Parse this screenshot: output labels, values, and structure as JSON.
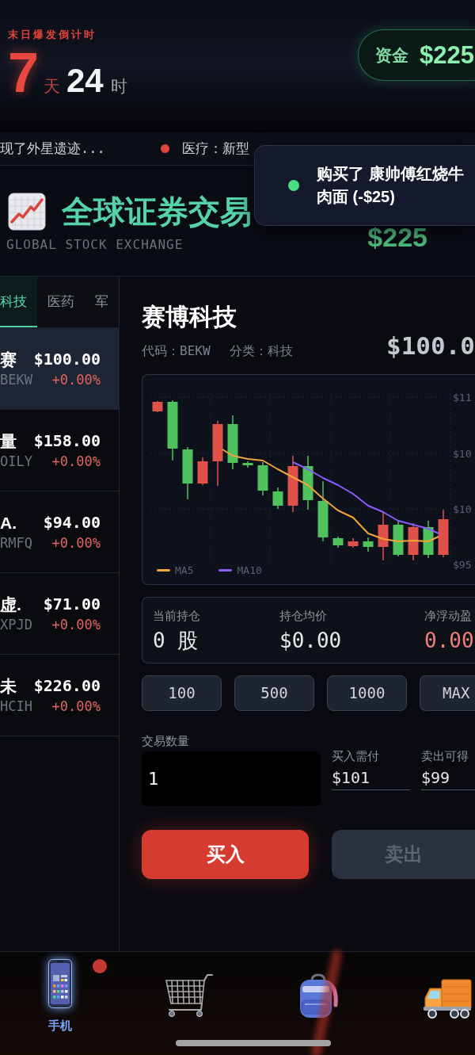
{
  "countdown": {
    "title": "末日爆发倒计时",
    "days": "7",
    "days_unit": "天",
    "hours": "24",
    "hours_unit": "时"
  },
  "funds": {
    "label": "资金",
    "amount": "$225"
  },
  "ticker": [
    {
      "text": "现了外星遗迹...",
      "bullet": false
    },
    {
      "text": "医疗：新型",
      "bullet": true
    }
  ],
  "toast": {
    "text": "购买了 康帅傅红烧牛肉面 (-$25)"
  },
  "exchange": {
    "title": "全球证券交易",
    "subtitle": "GLOBAL STOCK EXCHANGE",
    "balance": "$225"
  },
  "sectors": [
    {
      "label": "科技",
      "selected": true
    },
    {
      "label": "医药",
      "selected": false
    },
    {
      "label": "军",
      "selected": false
    }
  ],
  "stocks": [
    {
      "name": "赛",
      "code": "BEKW",
      "price": "$100.00",
      "change": "+0.00%",
      "selected": true
    },
    {
      "name": "量",
      "code": "OILY",
      "price": "$158.00",
      "change": "+0.00%",
      "selected": false
    },
    {
      "name": "A.",
      "code": "RMFQ",
      "price": "$94.00",
      "change": "+0.00%",
      "selected": false
    },
    {
      "name": "虚.",
      "code": "XPJD",
      "price": "$71.00",
      "change": "+0.00%",
      "selected": false
    },
    {
      "name": "未",
      "code": "HCIH",
      "price": "$226.00",
      "change": "+0.00%",
      "selected": false
    }
  ],
  "detail": {
    "name": "赛博科技",
    "code": "代码：BEKW",
    "sector": "分类：科技",
    "price": "$100.0"
  },
  "chart": {
    "y_labels": [
      "$11",
      "$10",
      "$10",
      "$95"
    ],
    "legend": [
      {
        "name": "MA5",
        "color": "#f0a43a"
      },
      {
        "name": "MA10",
        "color": "#8b5cf6"
      }
    ]
  },
  "position": [
    {
      "label": "当前持仓",
      "value": "0 股",
      "kind": "plain"
    },
    {
      "label": "持仓均价",
      "value": "$0.00",
      "kind": "plain"
    },
    {
      "label": "净浮动盈",
      "value": "0.00",
      "kind": "pnl"
    }
  ],
  "quantity_presets": [
    "100",
    "500",
    "1000",
    "MAX"
  ],
  "trade": {
    "quantity_label": "交易数量",
    "quantity": "1",
    "buy_cost_label": "买入需付",
    "buy_cost": "$101",
    "sell_gain_label": "卖出可得",
    "sell_gain": "$99"
  },
  "actions": [
    {
      "label": "买入",
      "kind": "buy",
      "disabled": false
    },
    {
      "label": "卖出",
      "kind": "sell",
      "disabled": true
    }
  ],
  "nav": [
    {
      "kind": "phone",
      "label": "手机",
      "selected": true,
      "badge": true
    },
    {
      "kind": "cart",
      "selected": false,
      "badge": false
    },
    {
      "kind": "backpack",
      "selected": false,
      "badge": false
    },
    {
      "kind": "truck",
      "selected": false,
      "badge": false
    }
  ]
}
